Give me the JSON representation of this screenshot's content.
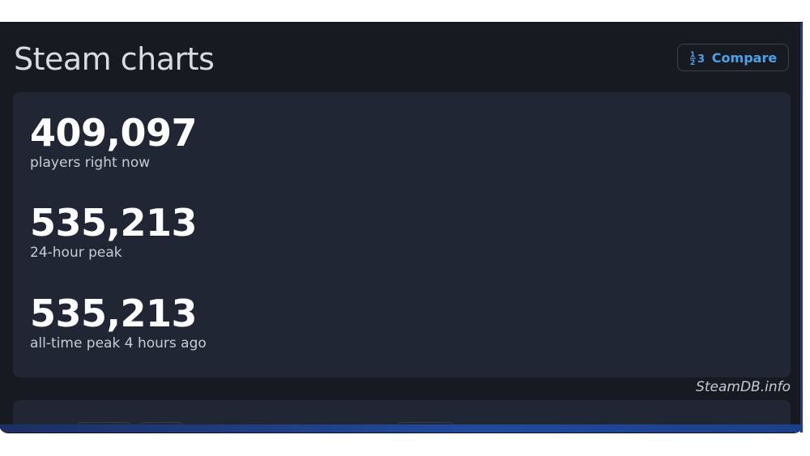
{
  "header": {
    "title": "Steam charts",
    "compare_button": {
      "icon": "numbers-icon",
      "label": "Compare"
    }
  },
  "stats": [
    {
      "value": "409,097",
      "label": "players right now"
    },
    {
      "value": "535,213",
      "label": "24-hour peak"
    },
    {
      "value": "535,213",
      "label": "all-time peak 4 hours ago"
    }
  ],
  "credit": "SteamDB.info",
  "colors": {
    "background": "#171a21",
    "card": "#202633",
    "accent": "#4aa3e8",
    "text_primary": "#ffffff",
    "text_secondary": "#c7ccd5"
  }
}
